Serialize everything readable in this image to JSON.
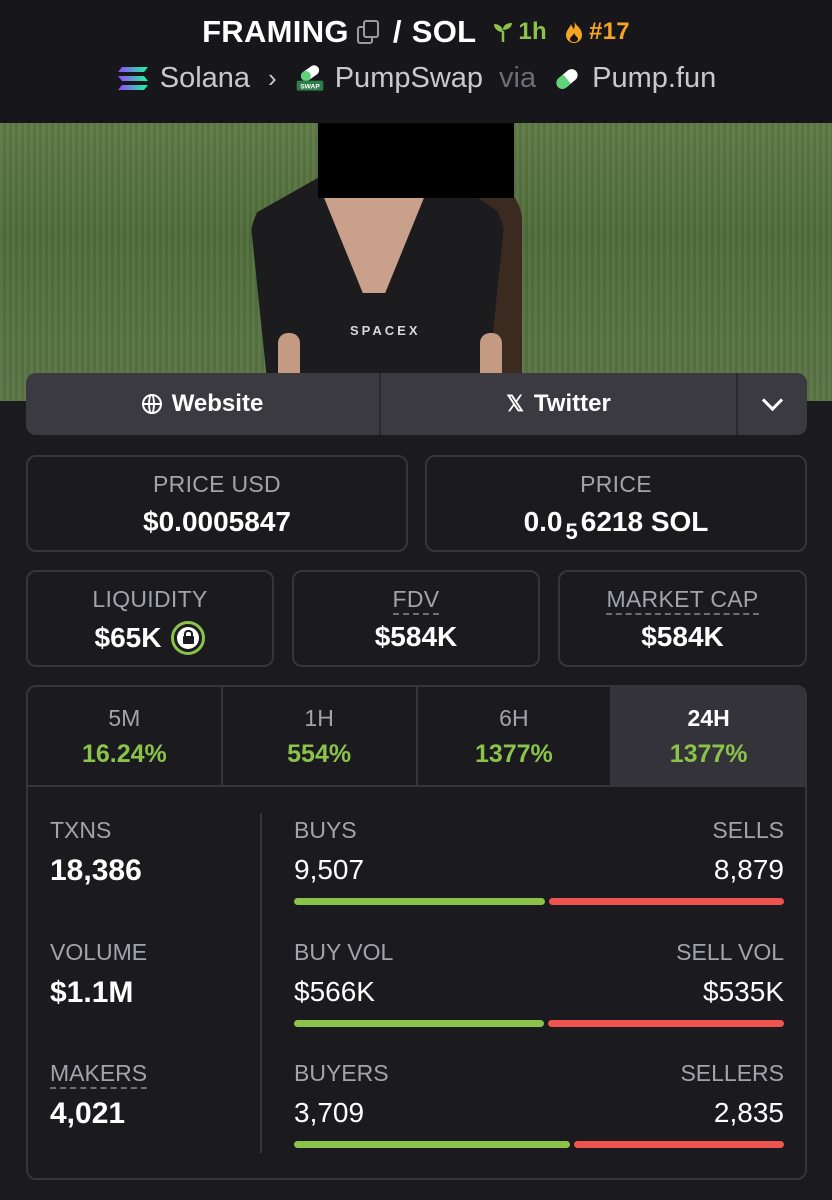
{
  "header": {
    "token": "FRAMING",
    "separator": "/",
    "quote": "SOL",
    "age": "1h",
    "rank": "#17",
    "chain": "Solana",
    "dex": "PumpSwap",
    "via": "via",
    "launchpad": "Pump.fun"
  },
  "banner": {
    "shirt_text": "SPACEX"
  },
  "links": {
    "website": "Website",
    "twitter": "Twitter"
  },
  "stats": {
    "price_usd_label": "PRICE USD",
    "price_usd": "$0.0005847",
    "price_label": "PRICE",
    "price_prefix": "0.0",
    "price_zeros": "5",
    "price_suffix": "6218 SOL",
    "liquidity_label": "LIQUIDITY",
    "liquidity": "$65K",
    "fdv_label": "FDV",
    "fdv": "$584K",
    "mcap_label": "MARKET CAP",
    "mcap": "$584K"
  },
  "timeframes": [
    {
      "label": "5M",
      "change": "16.24%"
    },
    {
      "label": "1H",
      "change": "554%"
    },
    {
      "label": "6H",
      "change": "1377%"
    },
    {
      "label": "24H",
      "change": "1377%"
    }
  ],
  "active_timeframe": "24H",
  "metrics": {
    "txns_label": "TXNS",
    "txns": "18,386",
    "volume_label": "VOLUME",
    "volume": "$1.1M",
    "makers_label": "MAKERS",
    "makers": "4,021"
  },
  "splits": {
    "buys_label": "BUYS",
    "sells_label": "SELLS",
    "buys": "9,507",
    "sells": "8,879",
    "buys_ratio": 0.517,
    "buyvol_label": "BUY VOL",
    "sellvol_label": "SELL VOL",
    "buyvol": "$566K",
    "sellvol": "$535K",
    "buyvol_ratio": 0.514,
    "buyers_label": "BUYERS",
    "sellers_label": "SELLERS",
    "buyers": "3,709",
    "sellers": "2,835",
    "buyers_ratio": 0.567
  },
  "colors": {
    "accent_green": "#8bc34a",
    "accent_red": "#ef5350",
    "rank_orange": "#f5a524"
  }
}
